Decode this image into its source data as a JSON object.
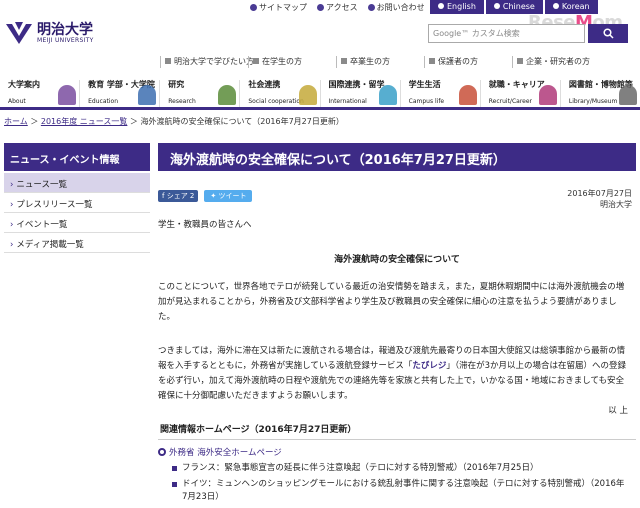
{
  "logo": {
    "name": "明治大学",
    "sub": "MEIJI UNIVERSITY"
  },
  "utility": [
    "サイトマップ",
    "アクセス",
    "お問い合わせ"
  ],
  "languages": [
    "English",
    "Chinese",
    "Korean"
  ],
  "brand": {
    "pre": "Rese",
    "o": "M",
    "post": "om"
  },
  "search": {
    "placeholder": "Google™ カスタム検索"
  },
  "audience": [
    "明治大学で学びたい方",
    "在学生の方",
    "卒業生の方",
    "保護者の方",
    "企業・研究者の方"
  ],
  "nav": [
    {
      "jp": "大学案内",
      "en": "About",
      "color": "#7a4ea0"
    },
    {
      "jp": "教育 学部・大学院",
      "en": "Education",
      "color": "#3d6fb0"
    },
    {
      "jp": "研究",
      "en": "Research",
      "color": "#5a8c3a"
    },
    {
      "jp": "社会連携",
      "en": "Social cooperation",
      "color": "#c4a93a"
    },
    {
      "jp": "国際連携・留学",
      "en": "International",
      "color": "#3aa0c8"
    },
    {
      "jp": "学生生活",
      "en": "Campus life",
      "color": "#c8503a"
    },
    {
      "jp": "就職・キャリア",
      "en": "Recruit/Career",
      "color": "#b03a7a"
    },
    {
      "jp": "図書館・博物館等",
      "en": "Library/Museum",
      "color": "#6a6a6a"
    }
  ],
  "breadcrumb": [
    "ホーム",
    "2016年度 ニュース一覧",
    "海外渡航時の安全確保について（2016年7月27日更新）"
  ],
  "sidebar": {
    "title": "ニュース・イベント情報",
    "items": [
      "ニュース一覧",
      "プレスリリース一覧",
      "イベント一覧",
      "メディア掲載一覧"
    ]
  },
  "article": {
    "title": "海外渡航時の安全確保について（2016年7月27日更新）",
    "share_fb": "シェア 2",
    "share_tw": "ツイート",
    "date": "2016年07月27日",
    "author": "明治大学",
    "greeting": "学生・教職員の皆さんへ",
    "notice_title": "海外渡航時の安全確保について",
    "p1": "このことについて，世界各地でテロが続発している最近の治安情勢を踏まえ，また，夏期休暇期間中には海外渡航機会の増加が見込まれることから，外務省及び文部科学省より学生及び教職員の安全確保に細心の注意を払うよう要請がありました。",
    "p2_a": "つきましては，海外に滞在又は新たに渡航される場合は，報道及び渡航先最寄りの日本国大使館又は総領事館から最新の情報を入手するとともに，外務省が実施している渡航登録サービス「",
    "p2_hl": "たびレジ",
    "p2_b": "」（滞在が3か月以上の場合は在留届）への登録を必ず行い，加えて海外渡航時の日程や渡航先での連絡先等を家族と共有した上で，いかなる国・地域におきましても安全確保に十分御配慮いただきますようお願いします。",
    "ijo": "以 上",
    "related_title": "関連情報ホームページ（2016年7月27日更新）",
    "related_head": "外務省 海外安全ホームページ",
    "related": [
      "フランス：緊急事態宣言の延長に伴う注意喚起（テロに対する特別警戒）（2016年7月25日）",
      "ドイツ：ミュンヘンのショッピングモールにおける銃乱射事件に関する注意喚起（テロに対する特別警戒）（2016年7月23日）"
    ]
  },
  "colors": {
    "primary": "#3d2b86",
    "sidebar_active": "#d8d3ea"
  }
}
